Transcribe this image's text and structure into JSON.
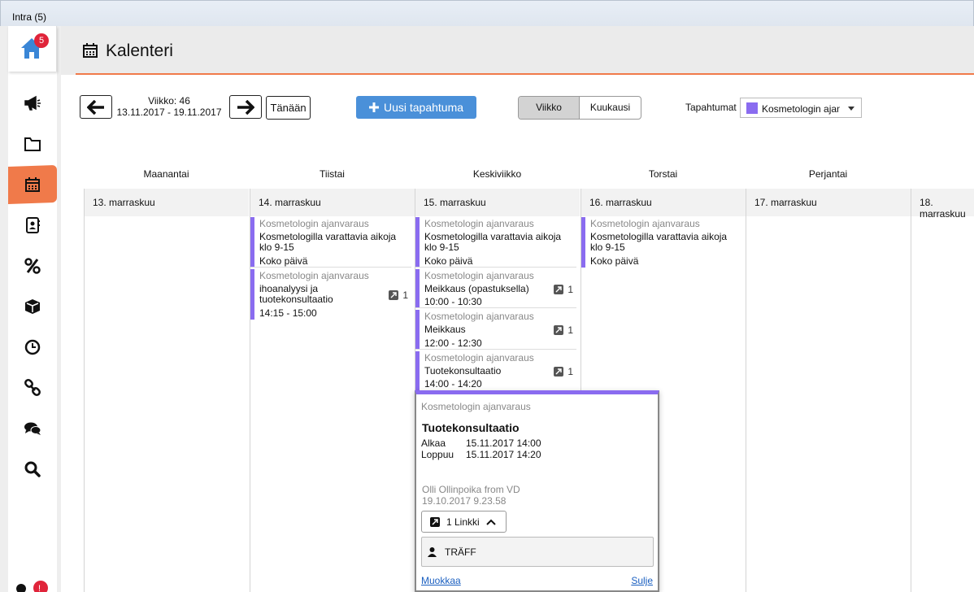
{
  "window": {
    "title": "Intra (5)"
  },
  "sidebar": {
    "home_badge": "5",
    "items": [
      {
        "icon": "megaphone-icon",
        "active": false
      },
      {
        "icon": "folder-icon",
        "active": false
      },
      {
        "icon": "calendar-icon",
        "active": true
      },
      {
        "icon": "contacts-icon",
        "active": false
      },
      {
        "icon": "percent-icon",
        "active": false
      },
      {
        "icon": "box-icon",
        "active": false
      },
      {
        "icon": "clock-icon",
        "active": false
      },
      {
        "icon": "link-icon",
        "active": false
      },
      {
        "icon": "chat-icon",
        "active": false
      },
      {
        "icon": "search-icon",
        "active": false
      }
    ]
  },
  "header": {
    "title": "Kalenteri"
  },
  "toolbar": {
    "week_label": "Viikko: 46",
    "date_range": "13.11.2017 - 19.11.2017",
    "today": "Tänään",
    "new_event": "Uusi tapahtuma",
    "view_week": "Viikko",
    "view_month": "Kuukausi",
    "events_label": "Tapahtumat",
    "events_filter": "Kosmetologin ajanvaraus",
    "filter_color": "#8a6cf0"
  },
  "days": [
    {
      "name": "Maanantai",
      "date": "13. marraskuu"
    },
    {
      "name": "Tiistai",
      "date": "14. marraskuu"
    },
    {
      "name": "Keskiviikko",
      "date": "15. marraskuu"
    },
    {
      "name": "Torstai",
      "date": "16. marraskuu"
    },
    {
      "name": "Perjantai",
      "date": "17. marraskuu"
    },
    {
      "name": "",
      "date": "18. marraskuu"
    }
  ],
  "events": {
    "tue": [
      {
        "category": "Kosmetologin ajanvaraus",
        "title": "Kosmetologilla varattavia aikoja klo 9-15",
        "time": "Koko päivä"
      },
      {
        "category": "Kosmetologin ajanvaraus",
        "title": "ihoanalyysi ja tuotekonsultaatio",
        "time": "14:15 - 15:00",
        "links": "1"
      }
    ],
    "wed": [
      {
        "category": "Kosmetologin ajanvaraus",
        "title": "Kosmetologilla varattavia aikoja klo 9-15",
        "time": "Koko päivä"
      },
      {
        "category": "Kosmetologin ajanvaraus",
        "title": "Meikkaus (opastuksella)",
        "time": "10:00 - 10:30",
        "links": "1"
      },
      {
        "category": "Kosmetologin ajanvaraus",
        "title": "Meikkaus",
        "time": "12:00 - 12:30",
        "links": "1"
      },
      {
        "category": "Kosmetologin ajanvaraus",
        "title": "Tuotekonsultaatio",
        "time": "14:00 - 14:20",
        "links": "1"
      }
    ],
    "thu": [
      {
        "category": "Kosmetologin ajanvaraus",
        "title": "Kosmetologilla varattavia aikoja klo 9-15",
        "time": "Koko päivä"
      }
    ]
  },
  "popup": {
    "category": "Kosmetologin ajanvaraus",
    "title": "Tuotekonsultaatio",
    "start_label": "Alkaa",
    "start_value": "15.11.2017 14:00",
    "end_label": "Loppuu",
    "end_value": "15.11.2017 14:20",
    "author": "Olli Ollinpoika from VD",
    "created": "19.10.2017 9.23.58",
    "links_button": "1 Linkki",
    "linked_user": "TRÄFF",
    "edit": "Muokkaa",
    "close": "Sulje"
  }
}
